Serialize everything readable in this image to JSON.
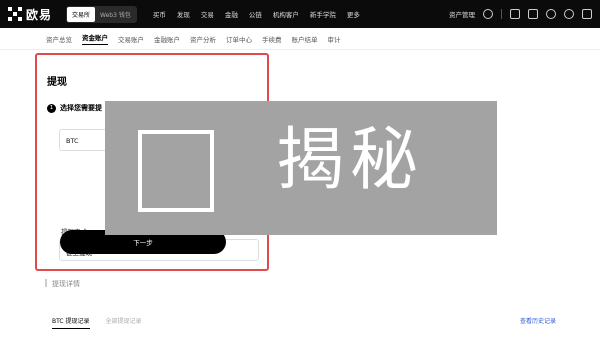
{
  "brand": {
    "name": "欧易"
  },
  "mode_toggle": {
    "exchange": "交易所",
    "web3": "Web3 钱包"
  },
  "nav": {
    "links": [
      "买币",
      "发现",
      "交易",
      "金融",
      "公链",
      "机构客户",
      "新手学院",
      "更多"
    ],
    "asset_menu": "资产管理"
  },
  "subnav": {
    "items": [
      "资产总览",
      "资金账户",
      "交易账户",
      "金融账户",
      "资产分析",
      "订单中心",
      "手续费",
      "账户结单",
      "审计"
    ],
    "active_index": 1
  },
  "withdraw": {
    "title": "提现",
    "step_number": "1",
    "step_text": "选择您需要提",
    "coin_value": "BTC",
    "method_label": "提现方式",
    "method_value": "链上提现",
    "next_button": "下一步"
  },
  "details": {
    "label": "提现详情"
  },
  "records": {
    "tabs": [
      "BTC 提现记录",
      "全部提现记录"
    ],
    "history_link": "查看历史记录"
  },
  "overlay": {
    "text": "揭秘"
  },
  "colors": {
    "highlight_border": "#e04a4a",
    "overlay_bg": "#a3a3a3",
    "link": "#2a5bd7"
  }
}
